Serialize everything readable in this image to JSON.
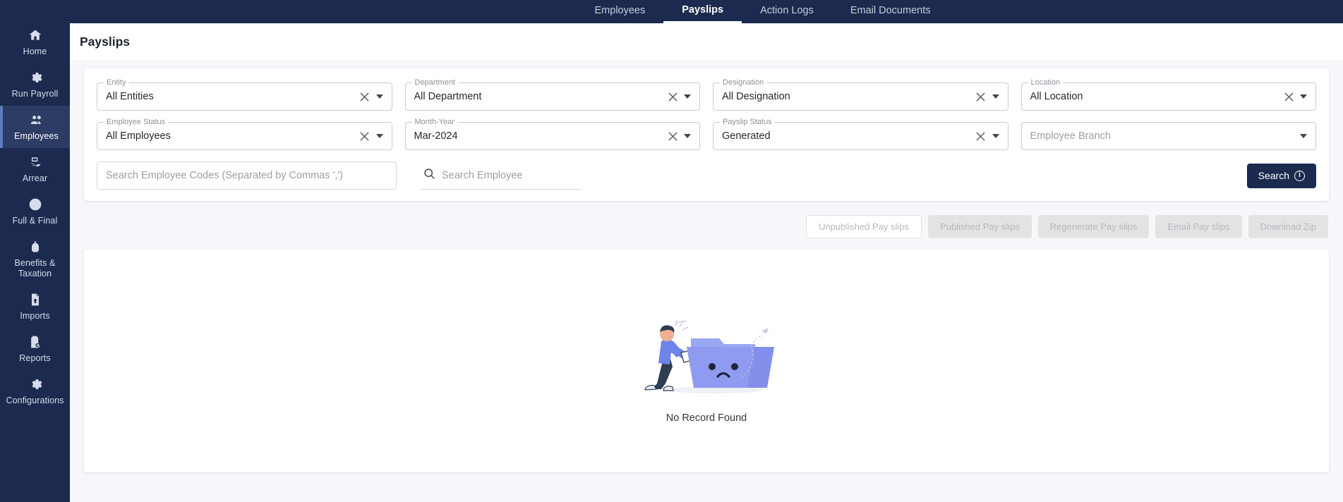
{
  "sidebar": {
    "items": [
      {
        "label": "Home",
        "icon": "home-icon",
        "active": false
      },
      {
        "label": "Run Payroll",
        "icon": "gear-icon",
        "active": false
      },
      {
        "label": "Employees",
        "icon": "people-icon",
        "active": true
      },
      {
        "label": "Arrear",
        "icon": "money-hand-icon",
        "active": false
      },
      {
        "label": "Full & Final",
        "icon": "refresh-icon",
        "active": false
      },
      {
        "label": "Benefits & Taxation",
        "icon": "bag-icon",
        "active": false
      },
      {
        "label": "Imports",
        "icon": "file-upload-icon",
        "active": false
      },
      {
        "label": "Reports",
        "icon": "clipboard-search-icon",
        "active": false
      },
      {
        "label": "Configurations",
        "icon": "gear-icon",
        "active": false
      }
    ]
  },
  "topnav": {
    "items": [
      {
        "label": "Employees",
        "active": false
      },
      {
        "label": "Payslips",
        "active": true
      },
      {
        "label": "Action Logs",
        "active": false
      },
      {
        "label": "Email Documents",
        "active": false
      }
    ]
  },
  "header": {
    "title": "Payslips"
  },
  "filters": {
    "entity": {
      "label": "Entity",
      "value": "All Entities",
      "clearable": true
    },
    "department": {
      "label": "Department",
      "value": "All Department",
      "clearable": true
    },
    "designation": {
      "label": "Designation",
      "value": "All Designation",
      "clearable": true
    },
    "location": {
      "label": "Location",
      "value": "All Location",
      "clearable": true
    },
    "employeeStatus": {
      "label": "Employee Status",
      "value": "All Employees",
      "clearable": true
    },
    "monthYear": {
      "label": "Month-Year",
      "value": "Mar-2024",
      "clearable": true
    },
    "payslipStatus": {
      "label": "Payslip Status",
      "value": "Generated",
      "clearable": true
    },
    "employeeBranch": {
      "label": "",
      "value": "Employee Branch",
      "clearable": false
    },
    "employeeCodes": {
      "placeholder": "Search Employee Codes (Separated by Commas ',')"
    },
    "employeeSearch": {
      "placeholder": "Search Employee",
      "icon": "search-icon"
    },
    "searchButton": {
      "label": "Search",
      "icon": "info-icon"
    }
  },
  "actions": {
    "buttons": [
      {
        "label": "Unpublished Pay slips",
        "disabled": true,
        "style": "outlined"
      },
      {
        "label": "Published Pay slips",
        "disabled": true,
        "style": "filled"
      },
      {
        "label": "Regenerate Pay slips",
        "disabled": true,
        "style": "filled"
      },
      {
        "label": "Email Pay slips",
        "disabled": true,
        "style": "filled"
      },
      {
        "label": "Download Zip",
        "disabled": true,
        "style": "filled"
      }
    ]
  },
  "results": {
    "empty_text": "No Record Found",
    "illustration": "empty-folder-illustration"
  },
  "colors": {
    "brand_navy": "#1b2a4e",
    "sidebar_active": "#2c3c64",
    "page_bg": "#f6f7fa",
    "illustration_purple": "#8e9bf0"
  }
}
